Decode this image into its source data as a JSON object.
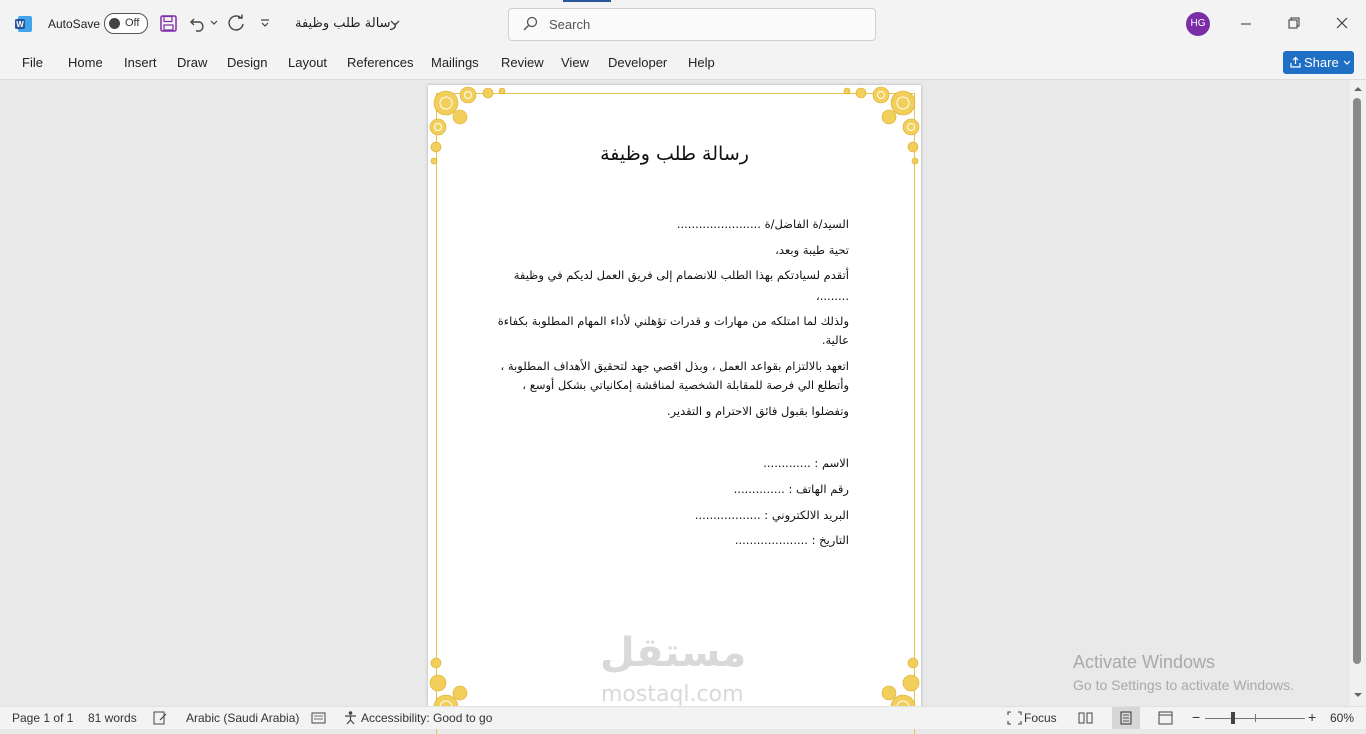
{
  "titlebar": {
    "autosave_label": "AutoSave",
    "autosave_state": "Off",
    "doc_title": "رسالة طلب وظيفة",
    "search_placeholder": "Search",
    "user_initials": "HG"
  },
  "ribbon": {
    "tabs": [
      "File",
      "Home",
      "Insert",
      "Draw",
      "Design",
      "Layout",
      "References",
      "Mailings",
      "Review",
      "View",
      "Developer",
      "Help"
    ],
    "share_label": "Share"
  },
  "document": {
    "title": "رسالة طلب وظيفة",
    "lines": [
      "السيد/ة الفاضل/ة .......................",
      "تحية طيبة وبعد،",
      "أتقدم لسيادتكم بهذا الطلب للانضمام إلى فريق العمل لديكم في وظيفة",
      "........،",
      "ولذلك لما امتلكه من مهارات و قدرات تؤهلني لأداء المهام المطلوبة بكفاءة",
      "عالية.",
      "اتعهد بالالتزام بقواعد العمل ، وبذل اقصي جهد لتحقيق الأهداف المطلوبة ،",
      "وأتطلع الي فرصة للمقابلة الشخصية لمناقشة إمكانياتي بشكل أوسع ،",
      "وتفضلوا بقبول فائق الاحترام و التقدير."
    ],
    "fields": [
      "الاسم : .............",
      "رقم الهاتف : ..............",
      "البريد الالكتروني : ..................",
      "التاريخ : ...................."
    ]
  },
  "watermark": {
    "arabic": "مستقل",
    "latin": "mostaql.com"
  },
  "activation": {
    "title": "Activate Windows",
    "subtitle": "Go to Settings to activate Windows."
  },
  "statusbar": {
    "page": "Page 1 of 1",
    "words": "81 words",
    "language": "Arabic (Saudi Arabia)",
    "accessibility": "Accessibility: Good to go",
    "focus": "Focus",
    "zoom": "60%"
  },
  "colors": {
    "word_blue": "#2b579a",
    "share_blue": "#1f6fc5",
    "avatar_purple": "#7a2da6",
    "frame_gold": "#e7c34a",
    "ornament_gold": "#f2cf5a"
  }
}
